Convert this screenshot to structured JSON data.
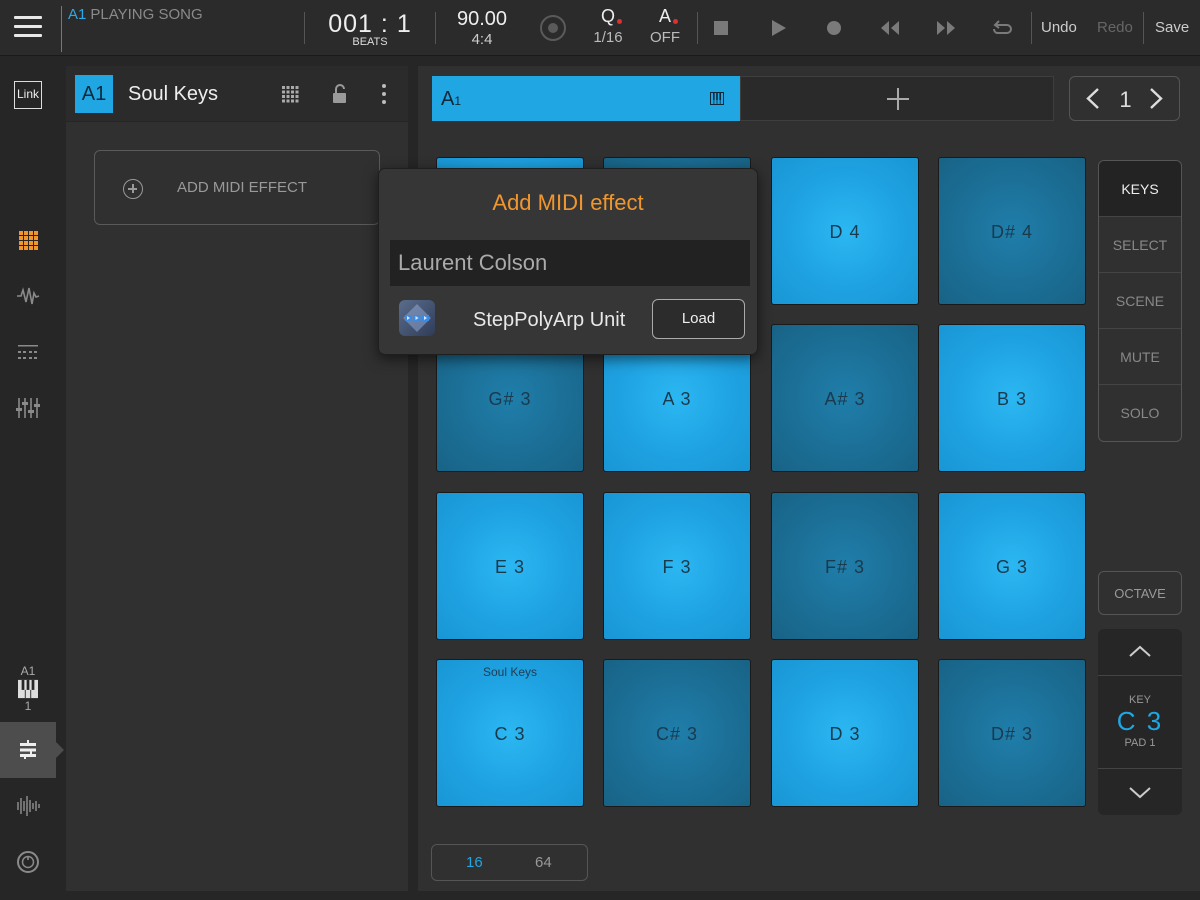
{
  "topbar": {
    "track_id": "A1",
    "status": "PLAYING SONG",
    "position_bar": "001",
    "position_sep": ":",
    "position_beat": "1",
    "position_unit": "BEATS",
    "tempo": "90.00",
    "time_signature": "4:4",
    "quantize_label": "Q",
    "quantize_value": "1/16",
    "auto_label": "A",
    "auto_value": "OFF",
    "undo_label": "Undo",
    "redo_label": "Redo",
    "save_label": "Save"
  },
  "rail": {
    "link_label": "Link",
    "track_label": "A1",
    "track_number": "1"
  },
  "left_panel": {
    "track_badge": "A1",
    "instrument_name": "Soul Keys",
    "add_midi_label": "ADD MIDI EFFECT"
  },
  "clip": {
    "name": "A",
    "sub": "1",
    "page": "1"
  },
  "pads": [
    {
      "note": "G# 3",
      "shade": "dark",
      "sub": ""
    },
    {
      "note": "A 3",
      "shade": "light",
      "sub": ""
    },
    {
      "note": "A# 3",
      "shade": "dark",
      "sub": ""
    },
    {
      "note": "B 3",
      "shade": "light",
      "sub": ""
    },
    {
      "note": "E 3",
      "shade": "light",
      "sub": ""
    },
    {
      "note": "F 3",
      "shade": "light",
      "sub": ""
    },
    {
      "note": "F# 3",
      "shade": "dark",
      "sub": ""
    },
    {
      "note": "G 3",
      "shade": "light",
      "sub": ""
    },
    {
      "note": "C 3",
      "shade": "light",
      "sub": "Soul Keys"
    },
    {
      "note": "C# 3",
      "shade": "dark",
      "sub": ""
    },
    {
      "note": "D 3",
      "shade": "light",
      "sub": ""
    },
    {
      "note": "D# 3",
      "shade": "dark",
      "sub": ""
    }
  ],
  "top_pads": [
    {
      "note": "",
      "shade": "light"
    },
    {
      "note": "",
      "shade": "dark"
    },
    {
      "note": "D 4",
      "shade": "light"
    },
    {
      "note": "D# 4",
      "shade": "dark"
    }
  ],
  "modes": [
    "KEYS",
    "SELECT",
    "SCENE",
    "MUTE",
    "SOLO"
  ],
  "active_mode": "KEYS",
  "octave": {
    "label": "OCTAVE",
    "key_label": "KEY",
    "key_value": "C 3",
    "pad_label": "PAD 1"
  },
  "bank": {
    "option_16": "16",
    "option_64": "64",
    "selected": "16"
  },
  "popup": {
    "title": "Add MIDI effect",
    "vendor": "Laurent Colson",
    "plugin_name": "StepPolyArp Unit",
    "load_label": "Load"
  },
  "colors": {
    "accent": "#1fa6e3",
    "popup_title": "#f0962f",
    "pad_light": "#1fa2e2",
    "pad_dark": "#1b6d94",
    "status_dot": "#e03030"
  }
}
